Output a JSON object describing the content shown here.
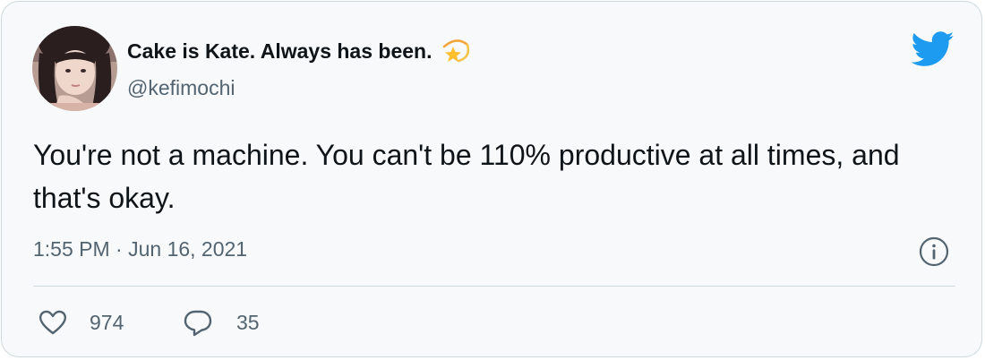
{
  "tweet": {
    "author": {
      "display_name": "Cake is Kate. Always has been.",
      "handle": "@kefimochi",
      "avatar_icon": "avatar-photo",
      "name_emoji_icon": "dizzy-star-icon"
    },
    "text": "You're not a machine. You can't be 110% productive at all times, and that's okay.",
    "timestamp": "1:55 PM · Jun 16, 2021",
    "actions": {
      "likes": "974",
      "replies": "35"
    }
  },
  "colors": {
    "twitter_blue": "#1d9bf0",
    "card_background": "#f7f9fa",
    "border": "#cfd9de",
    "secondary_text": "#536471",
    "primary_text": "#0f1419"
  }
}
